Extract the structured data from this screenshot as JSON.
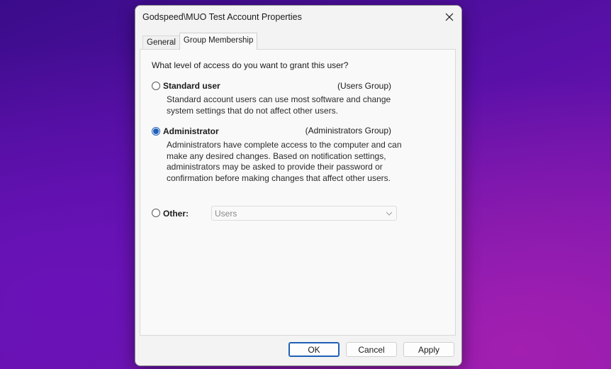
{
  "window": {
    "title": "Godspeed\\MUO Test Account Properties"
  },
  "tabs": [
    {
      "label": "General",
      "active": false
    },
    {
      "label": "Group Membership",
      "active": true
    }
  ],
  "question": "What level of access do you want to grant this user?",
  "options": {
    "standard": {
      "label": "Standard user",
      "group": "(Users Group)",
      "description": "Standard account users can use most software and change system settings that do not affect other users.",
      "checked": false
    },
    "administrator": {
      "label": "Administrator",
      "group": "(Administrators Group)",
      "description": "Administrators have complete access to the computer and can make any desired changes. Based on notification settings, administrators may be asked to provide their password or confirmation before making changes that affect other users.",
      "checked": true
    },
    "other": {
      "label": "Other:",
      "select_value": "Users",
      "checked": false
    }
  },
  "buttons": {
    "ok": "OK",
    "cancel": "Cancel",
    "apply": "Apply"
  },
  "colors": {
    "accent": "#1f5fb8"
  },
  "icons": {
    "close": "close-icon",
    "dropdown": "chevron-down-icon"
  }
}
